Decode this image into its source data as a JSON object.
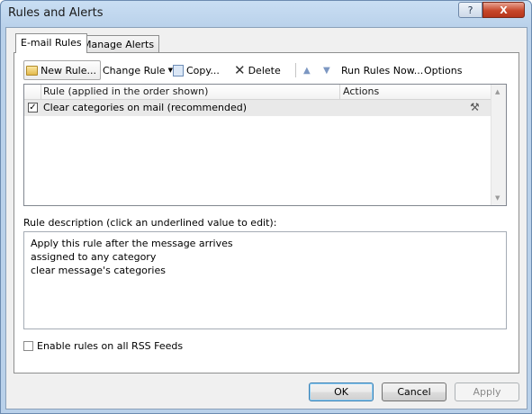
{
  "window": {
    "title": "Rules and Alerts",
    "help_label": "?",
    "close_label": "X"
  },
  "tabs": [
    {
      "label": "E-mail Rules",
      "active": true
    },
    {
      "label": "Manage Alerts",
      "active": false
    }
  ],
  "toolbar": {
    "new_rule": "New Rule...",
    "change_rule": "Change Rule",
    "copy": "Copy...",
    "delete": "Delete",
    "run_rules_now": "Run Rules Now...",
    "options": "Options"
  },
  "rules_list": {
    "columns": [
      "Rule (applied in the order shown)",
      "Actions"
    ],
    "rows": [
      {
        "checked": true,
        "name": "Clear categories on mail (recommended)"
      }
    ]
  },
  "description": {
    "label": "Rule description (click an underlined value to edit):",
    "lines": [
      "Apply this rule after the message arrives",
      "assigned to any category",
      "clear message's categories"
    ]
  },
  "rss": {
    "label": "Enable rules on all RSS Feeds",
    "checked": false
  },
  "buttons": {
    "ok": "OK",
    "cancel": "Cancel",
    "apply": "Apply"
  }
}
